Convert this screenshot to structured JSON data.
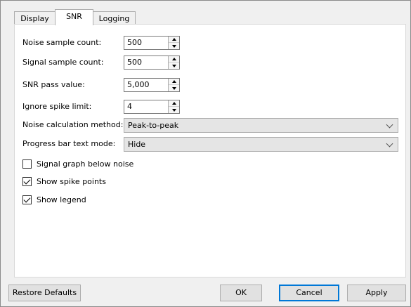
{
  "tabs": [
    {
      "label": "Display"
    },
    {
      "label": "SNR"
    },
    {
      "label": "Logging"
    }
  ],
  "active_tab": "SNR",
  "form": {
    "noise_sample_count": {
      "label": "Noise sample count:",
      "value": "500"
    },
    "signal_sample_count": {
      "label": "Signal sample count:",
      "value": "500"
    },
    "snr_pass_value": {
      "label": "SNR pass value:",
      "value": "5,000"
    },
    "ignore_spike_limit": {
      "label": "Ignore spike limit:",
      "value": "4"
    },
    "noise_calculation_method": {
      "label": "Noise calculation method:",
      "value": "Peak-to-peak"
    },
    "progress_bar_text_mode": {
      "label": "Progress bar text mode:",
      "value": "Hide"
    }
  },
  "checkboxes": {
    "signal_graph_below_noise": {
      "label": "Signal graph below noise",
      "checked": false
    },
    "show_spike_points": {
      "label": "Show spike points",
      "checked": true
    },
    "show_legend": {
      "label": "Show legend",
      "checked": true
    }
  },
  "buttons": {
    "restore_defaults": "Restore Defaults",
    "ok": "OK",
    "cancel": "Cancel",
    "apply": "Apply"
  },
  "colors": {
    "background": "#f0f0f0",
    "panel": "#ffffff",
    "default_button_border": "#0078d7"
  }
}
